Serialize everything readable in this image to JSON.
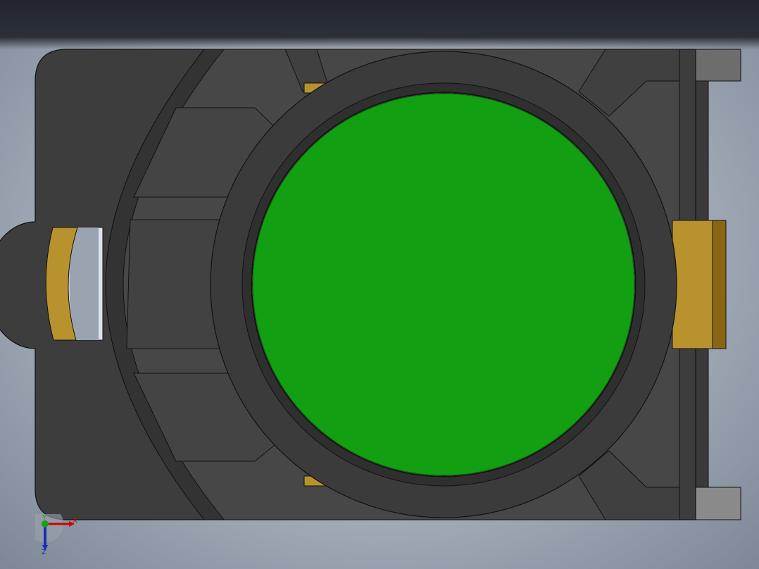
{
  "viewport": {
    "background_center": "#c9cfd8",
    "background_edge": "#7d8796"
  },
  "model": {
    "body_color": "#3c3c3c",
    "panel_color": "#464646",
    "ring_color": "#2c2c2c",
    "button_color": "#12a012",
    "brass_color": "#b8932d",
    "brass_dark_color": "#8a6614",
    "tab_color": "#6b6b6b"
  },
  "triad": {
    "x_label": "X",
    "y_label": "Y",
    "z_label": "Z",
    "x_color": "#cc0000",
    "y_color": "#1a9e1a",
    "z_color": "#1a2fb0"
  }
}
